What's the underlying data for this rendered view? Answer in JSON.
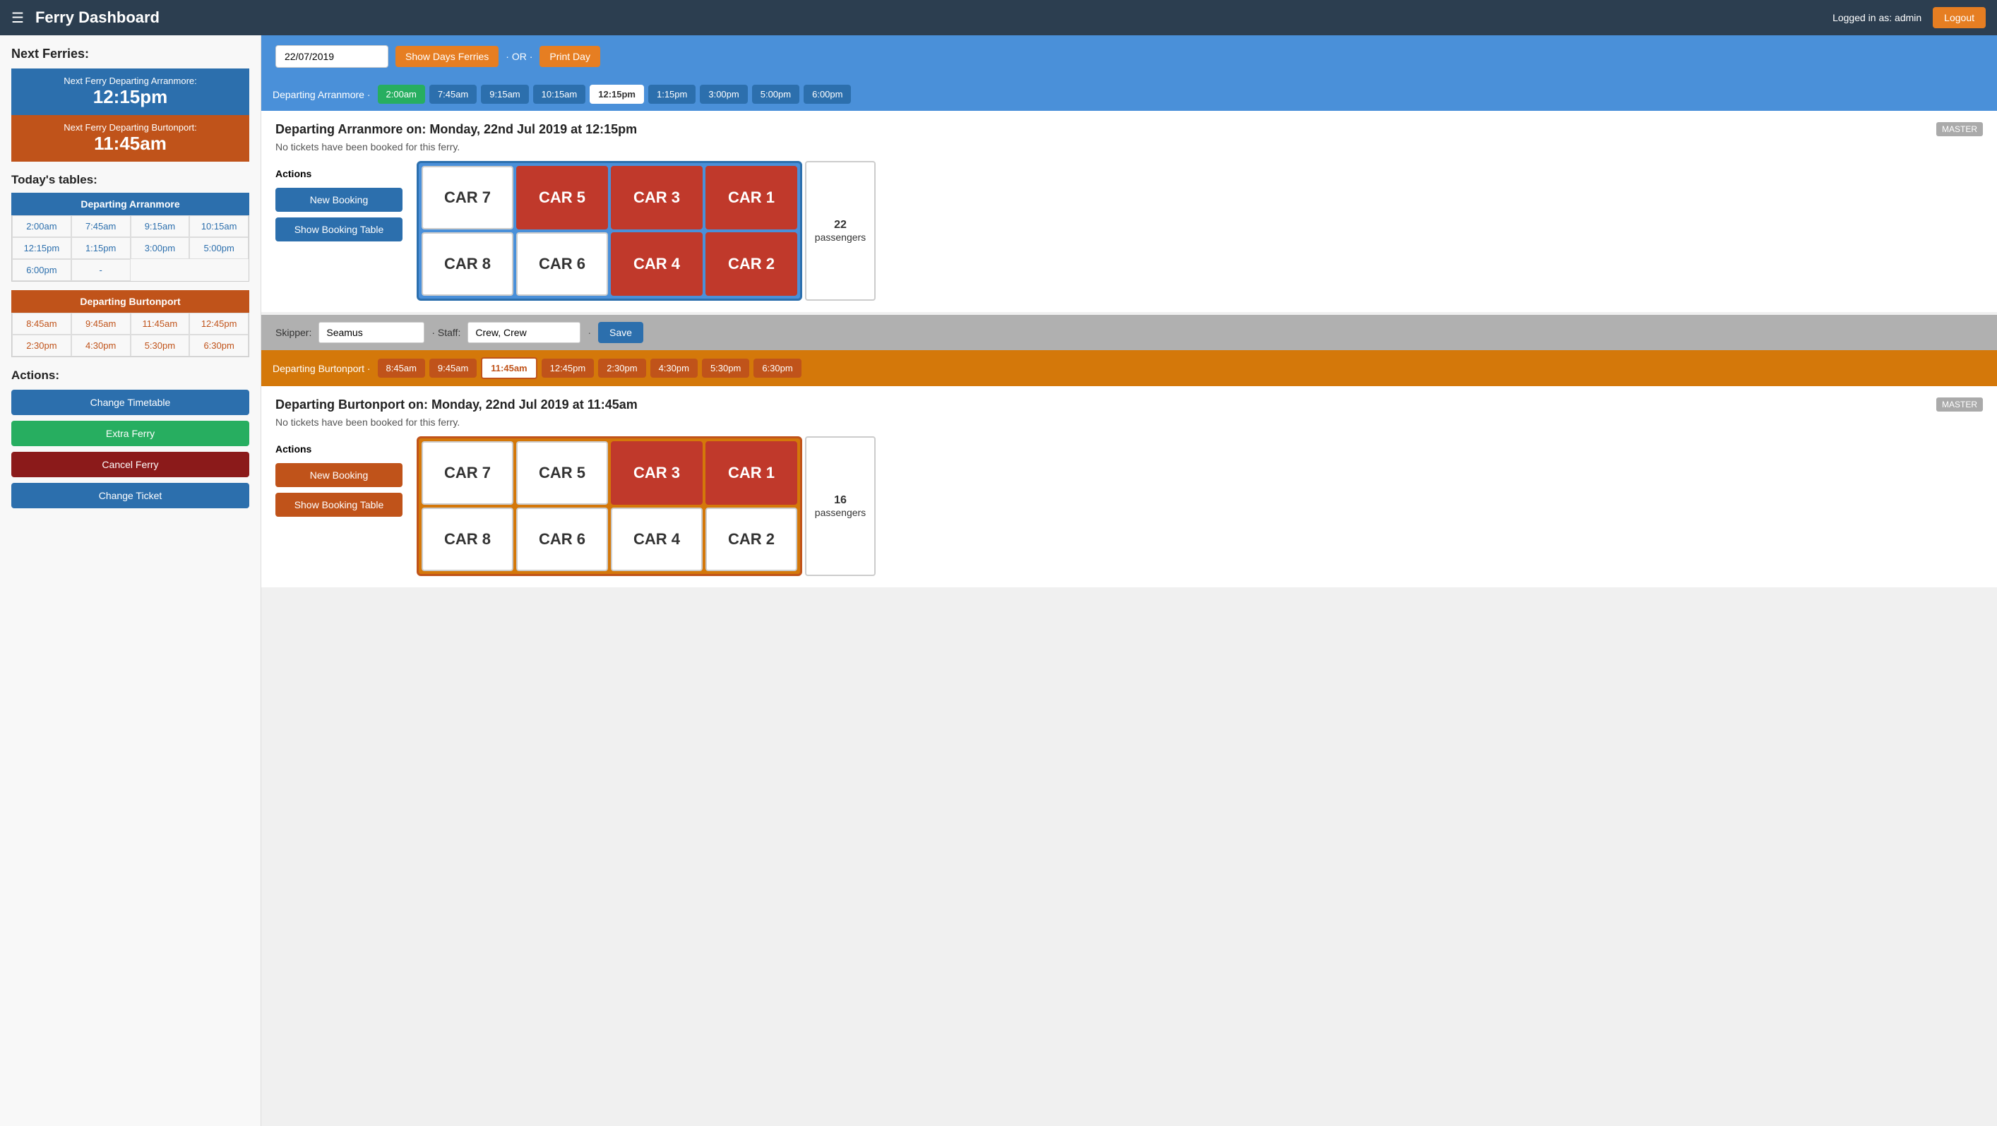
{
  "header": {
    "menu_icon": "☰",
    "title": "Ferry Dashboard",
    "user_text": "Logged in as: admin",
    "logout_label": "Logout"
  },
  "sidebar": {
    "next_ferries_title": "Next Ferries:",
    "next_arranmore_label": "Next Ferry Departing Arranmore:",
    "next_arranmore_time": "12:15pm",
    "next_burtonport_label": "Next Ferry Departing Burtonport:",
    "next_burtonport_time": "11:45am",
    "todays_tables_title": "Today's tables:",
    "arranmore_header": "Departing Arranmore",
    "arranmore_times": [
      "2:00am",
      "7:45am",
      "9:15am",
      "10:15am",
      "12:15pm",
      "1:15pm",
      "3:00pm",
      "5:00pm",
      "6:00pm",
      "-"
    ],
    "burtonport_header": "Departing Burtonport",
    "burtonport_times": [
      "8:45am",
      "9:45am",
      "11:45am",
      "12:45pm",
      "2:30pm",
      "4:30pm",
      "5:30pm",
      "6:30pm"
    ],
    "actions_title": "Actions:",
    "action_buttons": [
      {
        "label": "Change Timetable",
        "style": "blue"
      },
      {
        "label": "Extra Ferry",
        "style": "green"
      },
      {
        "label": "Cancel Ferry",
        "style": "darkred"
      },
      {
        "label": "Change Ticket",
        "style": "blue"
      }
    ]
  },
  "main": {
    "date_value": "22/07/2019",
    "show_days_label": "Show Days Ferries",
    "or_text": "· OR ·",
    "print_day_label": "Print Day",
    "arranmore_tabs": {
      "departing_label": "Departing Arranmore ·",
      "times": [
        "2:00am",
        "7:45am",
        "9:15am",
        "10:15am",
        "12:15pm",
        "1:15pm",
        "3:00pm",
        "5:00pm",
        "6:00pm"
      ],
      "active_green": "2:00am",
      "active_white": "12:15pm"
    },
    "burtonport_tabs": {
      "departing_label": "Departing Burtonport ·",
      "times": [
        "8:45am",
        "9:45am",
        "11:45am",
        "12:45pm",
        "2:30pm",
        "4:30pm",
        "5:30pm",
        "6:30pm"
      ],
      "active_white": "11:45am"
    },
    "arranmore_ferry": {
      "title": "Departing Arranmore on: Monday, 22nd Jul 2019 at 12:15pm",
      "subtitle": "No tickets have been booked for this ferry.",
      "master_badge": "MASTER",
      "actions_label": "Actions",
      "new_booking_label": "New Booking",
      "show_booking_label": "Show Booking Table",
      "cars_row1": [
        {
          "label": "CAR 7",
          "style": "white"
        },
        {
          "label": "CAR 5",
          "style": "red"
        },
        {
          "label": "CAR 3",
          "style": "red"
        },
        {
          "label": "CAR 1",
          "style": "red"
        }
      ],
      "cars_row2": [
        {
          "label": "CAR 8",
          "style": "white"
        },
        {
          "label": "CAR 6",
          "style": "white"
        },
        {
          "label": "CAR 4",
          "style": "red"
        },
        {
          "label": "CAR 2",
          "style": "red"
        }
      ],
      "passengers_count": "22",
      "passengers_label": "passengers",
      "skipper_label": "Skipper:",
      "skipper_value": "Seamus",
      "staff_label": "· Staff:",
      "staff_value": "Crew, Crew",
      "save_label": "·",
      "save_btn_label": "Save"
    },
    "burtonport_ferry": {
      "title": "Departing Burtonport on: Monday, 22nd Jul 2019 at 11:45am",
      "subtitle": "No tickets have been booked for this ferry.",
      "master_badge": "MASTER",
      "actions_label": "Actions",
      "new_booking_label": "New Booking",
      "show_booking_label": "Show Booking Table",
      "cars_row1": [
        {
          "label": "CAR 7",
          "style": "white"
        },
        {
          "label": "CAR 5",
          "style": "white"
        },
        {
          "label": "CAR 3",
          "style": "red"
        },
        {
          "label": "CAR 1",
          "style": "red"
        }
      ],
      "cars_row2": [
        {
          "label": "CAR 8",
          "style": "white"
        },
        {
          "label": "CAR 6",
          "style": "white"
        },
        {
          "label": "CAR 4",
          "style": "white"
        },
        {
          "label": "CAR 2",
          "style": "white"
        }
      ],
      "passengers_count": "16",
      "passengers_label": "passengers"
    }
  }
}
